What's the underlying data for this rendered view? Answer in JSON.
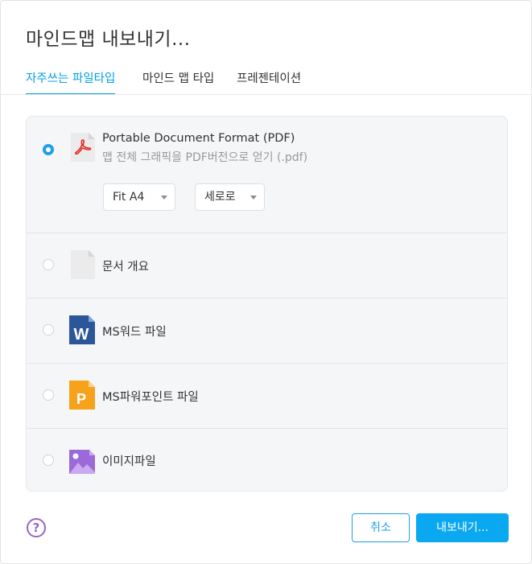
{
  "dialog": {
    "title": "마인드맵 내보내기..."
  },
  "tabs": [
    {
      "label": "자주쓰는 파일타입",
      "active": true
    },
    {
      "label": "마인드 맵 타입",
      "active": false
    },
    {
      "label": "프레젠테이션",
      "active": false
    }
  ],
  "options": {
    "pdf": {
      "label": "Portable Document Format (PDF)",
      "description": "맵 전체 그래픽을 PDF버전으로 얻기 (.pdf)",
      "selected": true,
      "page_size_value": "Fit A4",
      "orientation_value": "세로로"
    },
    "outline": {
      "label": "문서 개요",
      "selected": false
    },
    "word": {
      "label": "MS워드 파일",
      "selected": false,
      "icon_letter": "W"
    },
    "powerpoint": {
      "label": "MS파워포인트 파일",
      "selected": false,
      "icon_letter": "P"
    },
    "image": {
      "label": "이미지파일",
      "selected": false
    }
  },
  "footer": {
    "help_symbol": "?",
    "cancel_label": "취소",
    "export_label": "내보내기..."
  },
  "colors": {
    "accent": "#00a0e9",
    "primary_button": "#09a8f0",
    "help": "#9a63c6",
    "pdf_icon": "#e3261c",
    "word_icon": "#2b579a",
    "powerpoint_icon": "#f7a21b",
    "image_icon": "#9b6ad8"
  }
}
